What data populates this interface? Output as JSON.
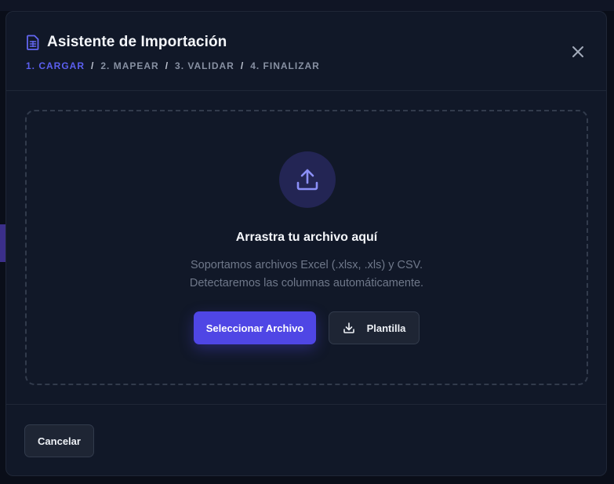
{
  "modal": {
    "title": "Asistente de Importación",
    "title_icon": "document-icon",
    "close_icon": "close-icon",
    "steps": [
      {
        "label": "1. CARGAR",
        "active": true
      },
      {
        "label": "2. MAPEAR",
        "active": false
      },
      {
        "label": "3. VALIDAR",
        "active": false
      },
      {
        "label": "4. FINALIZAR",
        "active": false
      }
    ],
    "step_separator": "/"
  },
  "dropzone": {
    "icon": "upload-icon",
    "title": "Arrastra tu archivo aquí",
    "subtitle_line1": "Soportamos archivos Excel (.xlsx, .xls) y CSV.",
    "subtitle_line2": "Detectaremos las columnas automáticamente.",
    "select_button": "Seleccionar Archivo",
    "template_button": "Plantilla",
    "template_icon": "download-icon"
  },
  "footer": {
    "cancel_button": "Cancelar"
  },
  "colors": {
    "accent": "#4f46e5",
    "active_step": "#5b5ff0",
    "modal_bg": "#111828",
    "upload_circle": "#232554"
  }
}
